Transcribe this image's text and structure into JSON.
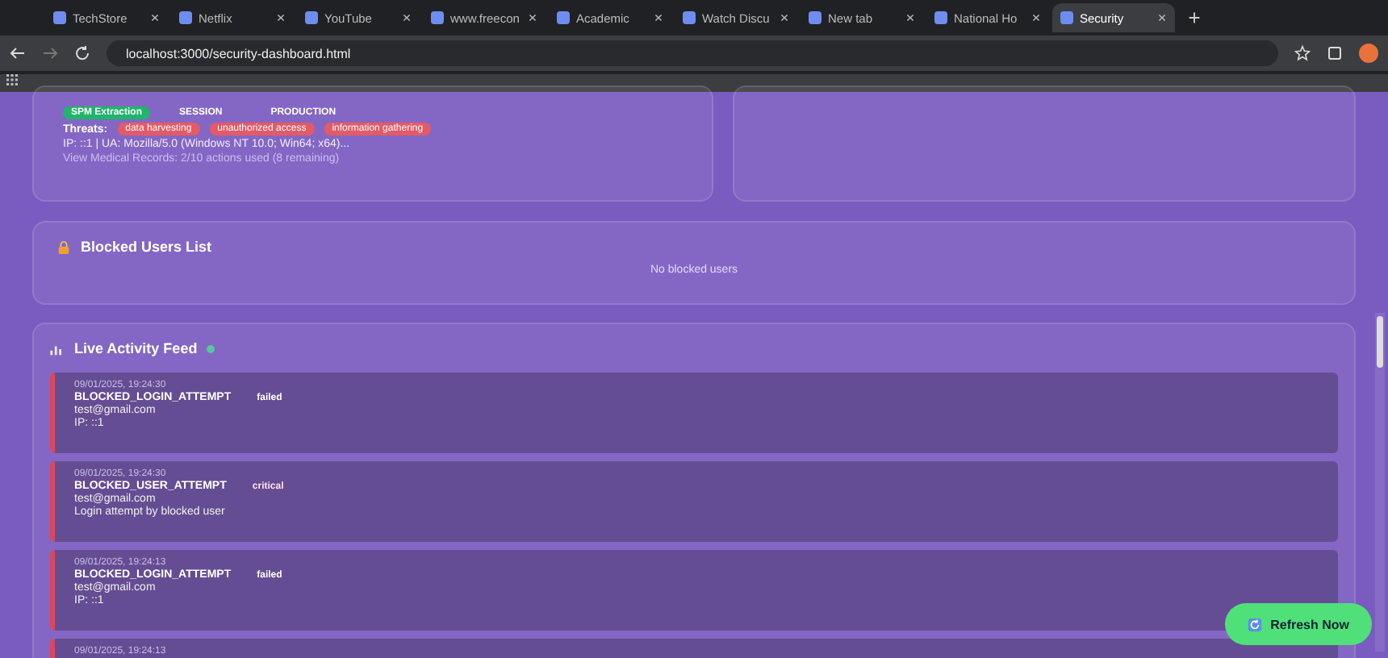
{
  "browser": {
    "tabs": [
      {
        "label": "TechStore",
        "selected": false
      },
      {
        "label": "Netflix",
        "selected": false
      },
      {
        "label": "YouTube",
        "selected": false
      },
      {
        "label": "www.freecon",
        "selected": false
      },
      {
        "label": "Academic",
        "selected": false
      },
      {
        "label": "Watch Discu",
        "selected": false
      },
      {
        "label": "New tab",
        "selected": false
      },
      {
        "label": "National Ho",
        "selected": false
      },
      {
        "label": "Security",
        "selected": true
      }
    ],
    "url": "localhost:3000/security-dashboard.html"
  },
  "session_card": {
    "badges": [
      {
        "label": "SPM Extraction",
        "kind": "status"
      },
      {
        "label": "SESSION",
        "kind": "plain"
      },
      {
        "label": "PRODUCTION",
        "kind": "plain"
      }
    ],
    "threats_label": "Threats:",
    "threats": [
      "data harvesting",
      "unauthorized access",
      "information gathering"
    ],
    "client": "IP: ::1 | UA: Mozilla/5.0 (Windows NT 10.0; Win64; x64)...",
    "usage": "View Medical Records: 2/10 actions used (8 remaining)"
  },
  "blocked_users": {
    "title": "Blocked Users List",
    "empty": "No blocked users"
  },
  "activity_feed": {
    "title": "Live Activity Feed",
    "entries": [
      {
        "time": "09/01/2025, 19:24:30",
        "event": "BLOCKED_LOGIN_ATTEMPT",
        "severity": "failed",
        "email": "test@gmail.com",
        "detail": "IP: ::1"
      },
      {
        "time": "09/01/2025, 19:24:30",
        "event": "BLOCKED_USER_ATTEMPT",
        "severity": "critical",
        "email": "test@gmail.com",
        "detail": "Login attempt by blocked user"
      },
      {
        "time": "09/01/2025, 19:24:13",
        "event": "BLOCKED_LOGIN_ATTEMPT",
        "severity": "failed",
        "email": "test@gmail.com",
        "detail": "IP: ::1"
      },
      {
        "time": "09/01/2025, 19:24:13"
      }
    ]
  },
  "refresh_button": "Refresh Now"
}
